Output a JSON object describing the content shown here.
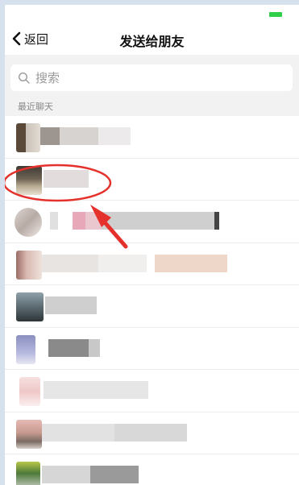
{
  "header": {
    "back_label": "返回",
    "title": "发送给朋友"
  },
  "search": {
    "placeholder": "搜索"
  },
  "section": {
    "recent_label": "最近聊天"
  },
  "colors": {
    "battery": "#2fcf4a",
    "annotation_red": "#e5312c",
    "frame": "#d7e1ee"
  },
  "icons": {
    "back": "chevron-left-icon",
    "search": "search-icon"
  },
  "contacts": [
    {
      "name": ""
    },
    {
      "name": ""
    },
    {
      "name": ""
    },
    {
      "name": ""
    },
    {
      "name": ""
    },
    {
      "name": ""
    },
    {
      "name": ""
    },
    {
      "name": ""
    },
    {
      "name": ""
    }
  ]
}
